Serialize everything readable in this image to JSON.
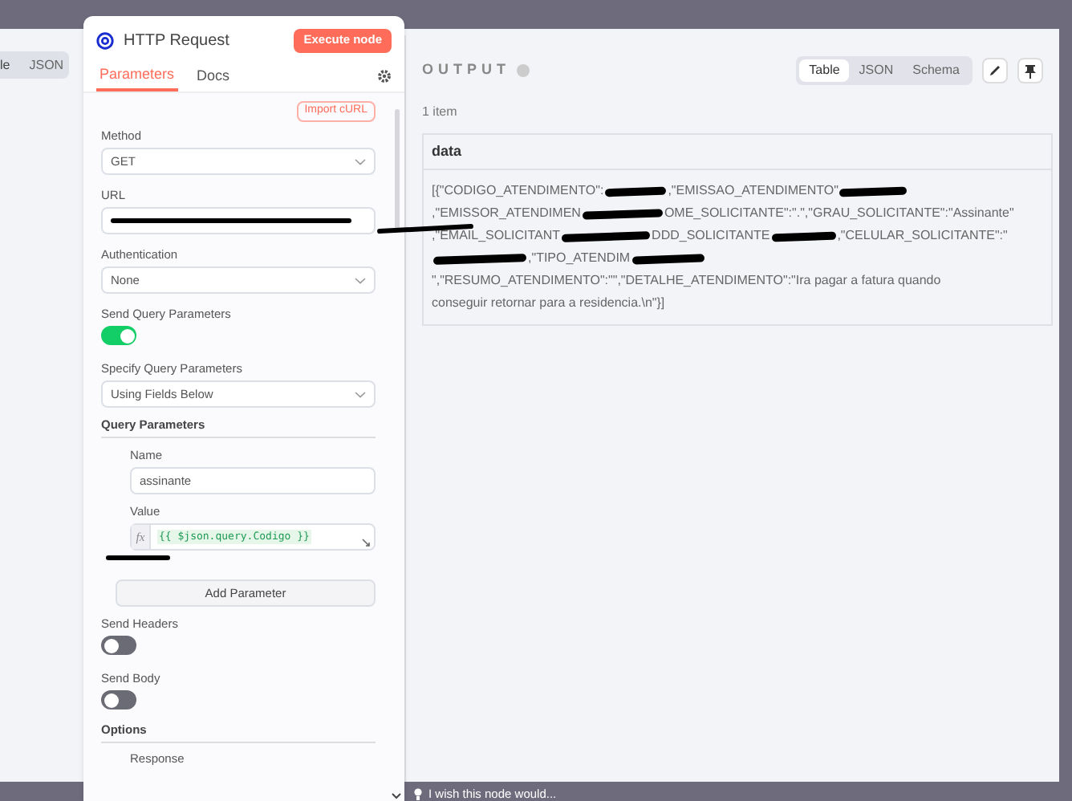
{
  "background_panel": {
    "tabs": [
      {
        "label": "le",
        "selected": true
      },
      {
        "label": "JSON",
        "selected": false
      }
    ]
  },
  "node_panel": {
    "title": "HTTP Request",
    "execute_button": "Execute node",
    "tabs": [
      {
        "label": "Parameters",
        "selected": true
      },
      {
        "label": "Docs",
        "selected": false
      }
    ],
    "import_button": "Import cURL",
    "fields": [
      {
        "kind": "select",
        "label": "Method",
        "value": "GET"
      },
      {
        "kind": "text",
        "label": "URL",
        "redacted": true
      },
      {
        "kind": "select",
        "label": "Authentication",
        "value": "None"
      },
      {
        "kind": "toggle",
        "label": "Send Query Parameters",
        "on": true
      },
      {
        "kind": "select",
        "label": "Specify Query Parameters",
        "value": "Using Fields Below"
      },
      {
        "kind": "collection",
        "label": "Query Parameters",
        "name_label": "Name",
        "name_value": "assinante",
        "value_label": "Value",
        "expression_prefix": "fx",
        "value_expression": "{{ $json.query.Codigo }}",
        "add_button": "Add Parameter"
      },
      {
        "kind": "toggle",
        "label": "Send Headers",
        "on": false
      },
      {
        "kind": "toggle",
        "label": "Send Body",
        "on": false
      },
      {
        "kind": "section",
        "label": "Options",
        "sub_label": "Response"
      }
    ]
  },
  "output": {
    "title": "OUTPUT",
    "view_tabs": [
      {
        "label": "Table",
        "selected": true
      },
      {
        "label": "JSON",
        "selected": false
      },
      {
        "label": "Schema",
        "selected": false
      }
    ],
    "count": "1 item",
    "table": {
      "columns": [
        "data"
      ],
      "rows": [
        [
          [
            {
              "kind": "text",
              "text": "[{\"CODIGO_ATENDIMENTO\":"
            },
            {
              "kind": "redaction"
            },
            {
              "kind": "text",
              "text": ",\"EMISSAO_ATENDIMENTO\""
            },
            {
              "kind": "redaction"
            },
            {
              "kind": "text",
              "text": ",\"EMISSOR_ATENDIMEN"
            },
            {
              "kind": "redaction"
            },
            {
              "kind": "text",
              "text": "OME_SOLICITANTE\":\".\",\"GRAU_SOLICITANTE\":\"Assinante\""
            },
            {
              "kind": "text",
              "text": ",\"EMAIL_SOLICITANT"
            },
            {
              "kind": "redaction"
            },
            {
              "kind": "text",
              "text": "DDD_SOLICITANTE"
            },
            {
              "kind": "redaction"
            },
            {
              "kind": "text",
              "text": ",\"CELULAR_SOLICITANTE\":\""
            },
            {
              "kind": "redaction"
            },
            {
              "kind": "text",
              "text": ",\"TIPO_ATENDIM"
            },
            {
              "kind": "redaction"
            },
            {
              "kind": "text",
              "text": "\",\"RESUMO_ATENDIMENTO\":\"\",\"DETALHE_ATENDIMENTO\":\"Ira pagar a fatura quando"
            },
            {
              "kind": "text",
              "text": "conseguir retornar para a residencia.\\n\"}]"
            }
          ]
        ]
      ]
    }
  },
  "feedback_bar": {
    "text": "I wish this node would..."
  }
}
